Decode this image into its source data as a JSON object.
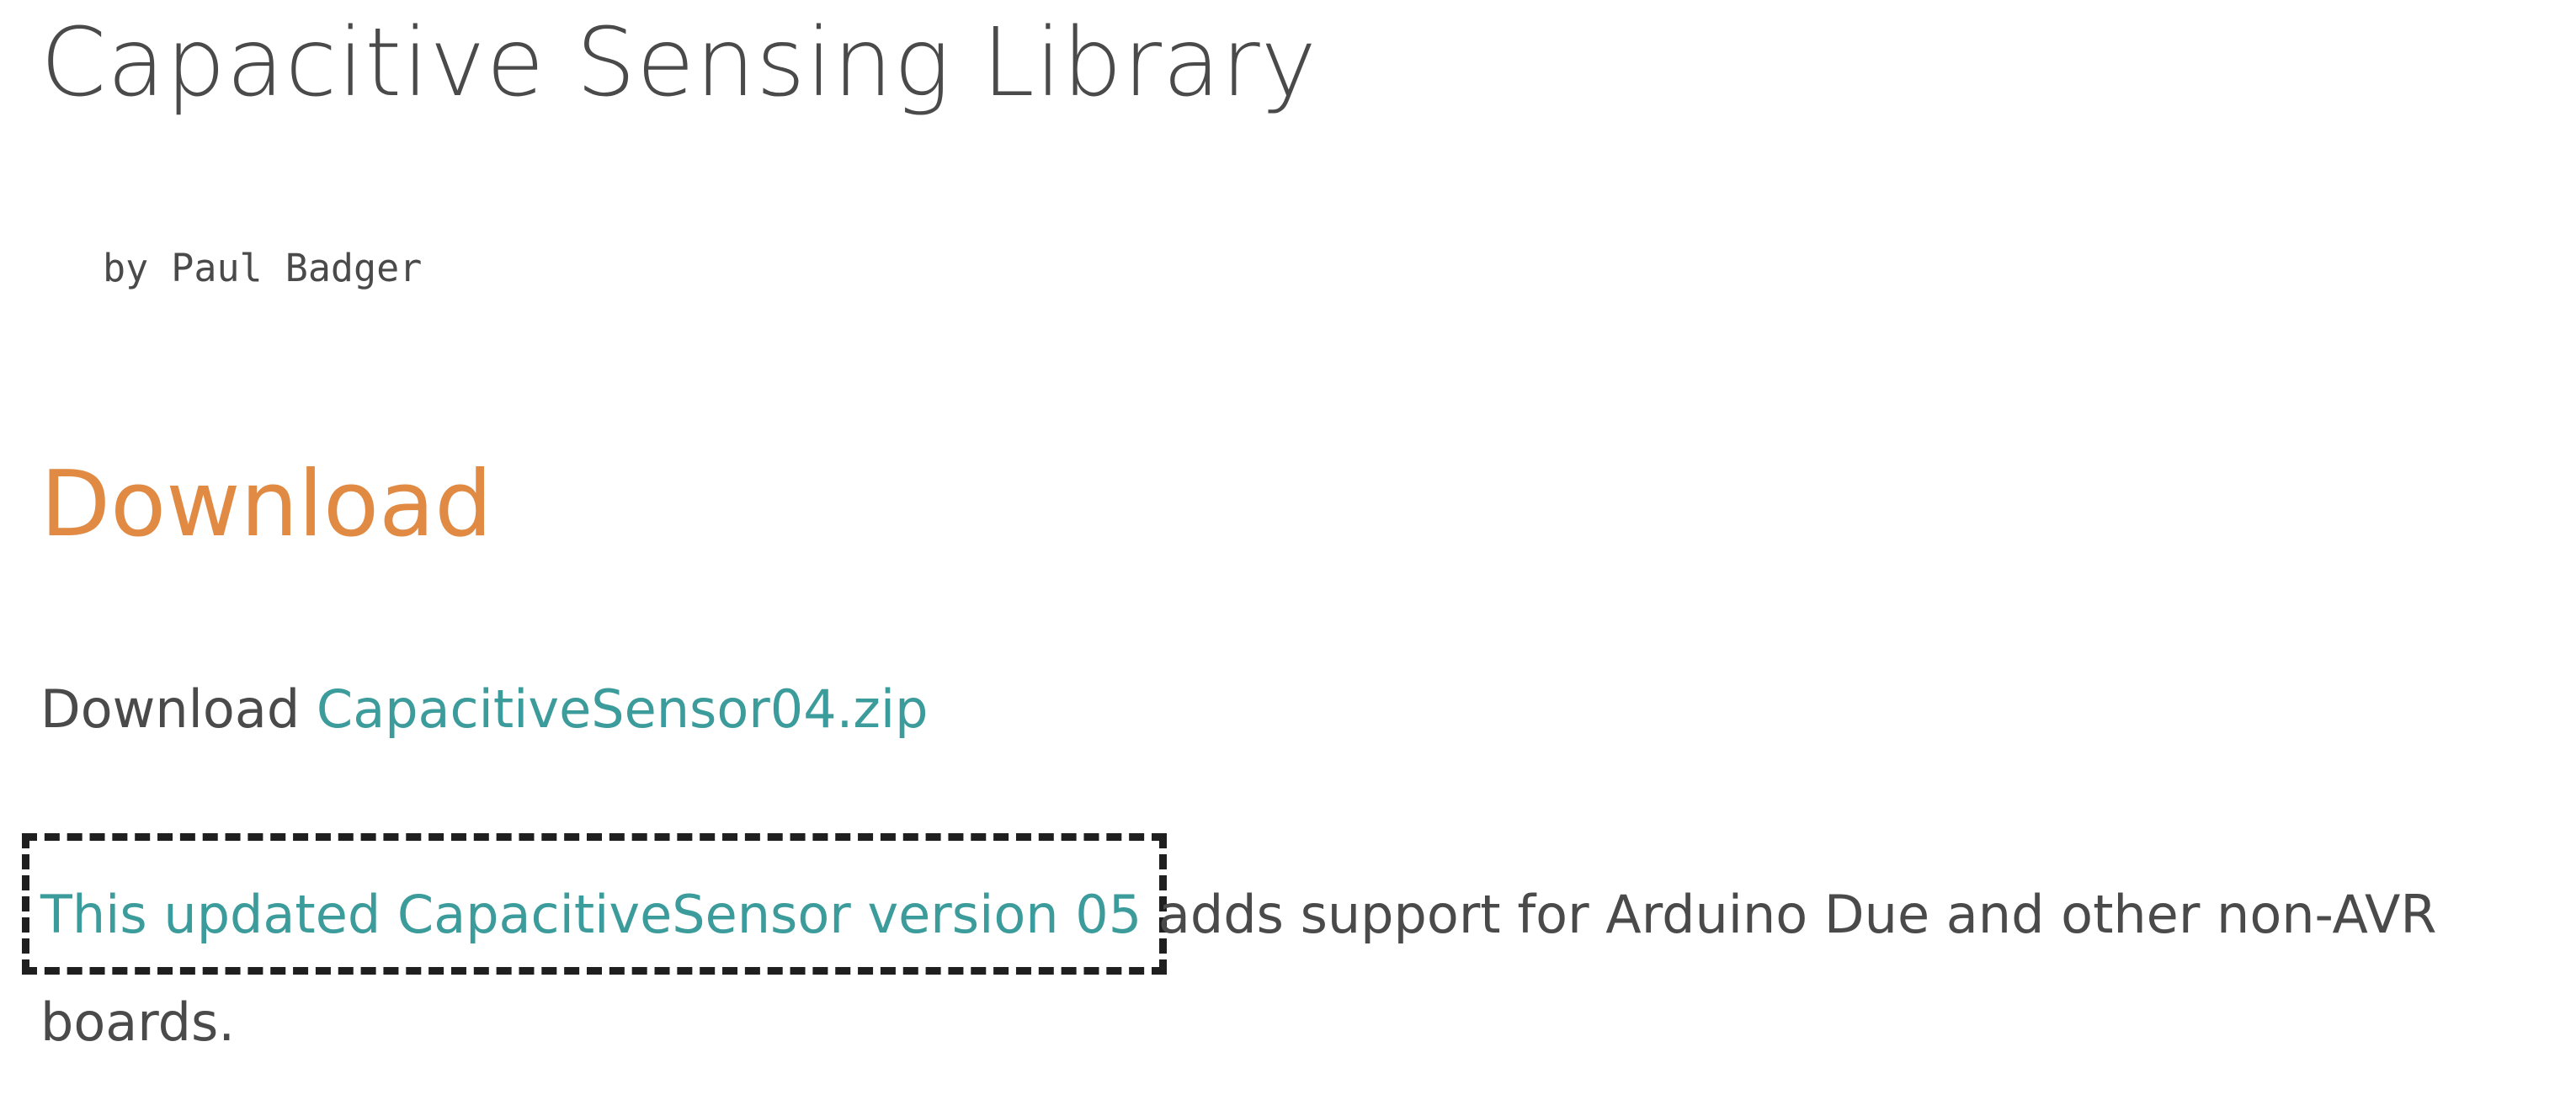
{
  "page": {
    "title": "Capacitive Sensing Library",
    "byline": "by Paul Badger"
  },
  "download_section": {
    "heading": "Download",
    "download_prefix": "Download ",
    "download_link": "CapacitiveSensor04.zip",
    "update_link": "This updated CapacitiveSensor version 05",
    "update_text": " adds support for Arduino Due and other non-AVR",
    "update_text_2": "boards."
  }
}
